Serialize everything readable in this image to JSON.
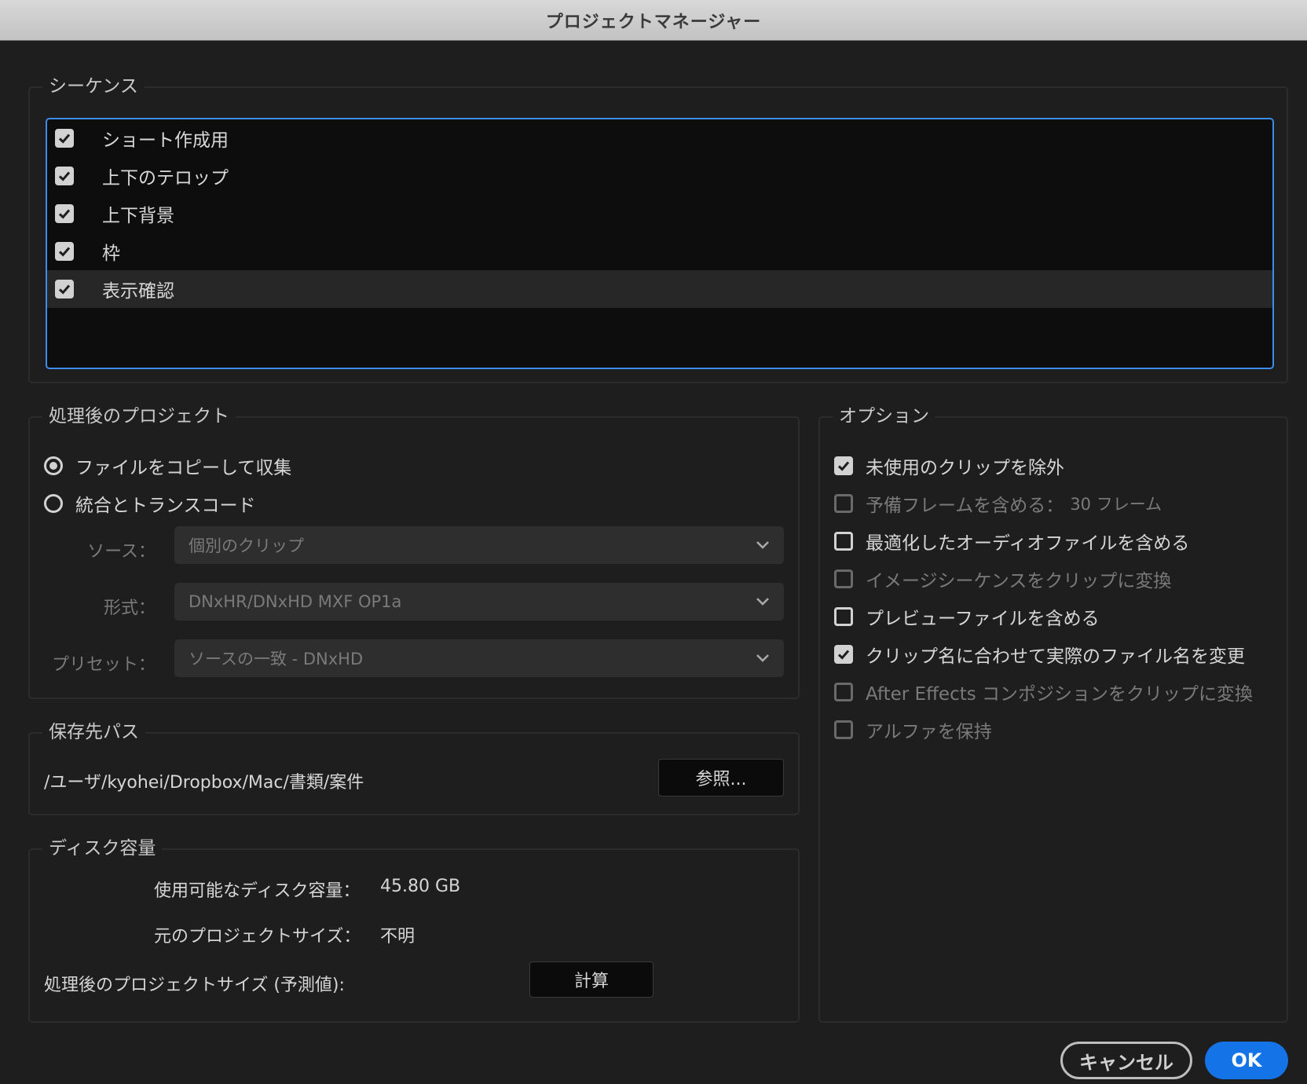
{
  "window": {
    "title": "プロジェクトマネージャー"
  },
  "sequences": {
    "legend": "シーケンス",
    "items": [
      {
        "label": "ショート作成用",
        "checked": true
      },
      {
        "label": "上下のテロップ",
        "checked": true
      },
      {
        "label": "上下背景",
        "checked": true
      },
      {
        "label": "枠",
        "checked": true
      },
      {
        "label": "表示確認",
        "checked": true
      }
    ]
  },
  "result_project": {
    "legend": "処理後のプロジェクト",
    "collect_label": "ファイルをコピーして収集",
    "transcode_label": "統合とトランスコード",
    "selected": "collect",
    "source_label": "ソース：",
    "source_value": "個別のクリップ",
    "format_label": "形式：",
    "format_value": "DNxHR/DNxHD MXF OP1a",
    "preset_label": "プリセット：",
    "preset_value": "ソースの一致 - DNxHD"
  },
  "destination": {
    "legend": "保存先パス",
    "path": "/ユーザ/kyohei/Dropbox/Mac/書類/案件",
    "browse_label": "参照..."
  },
  "disk": {
    "legend": "ディスク容量",
    "available_label": "使用可能なディスク容量：",
    "available_value": "45.80 GB",
    "original_label": "元のプロジェクトサイズ：",
    "original_value": "不明",
    "estimated_label": "処理後のプロジェクトサイズ (予測値):",
    "calculate_label": "計算"
  },
  "options": {
    "legend": "オプション",
    "items": [
      {
        "label": "未使用のクリップを除外",
        "checked": true,
        "enabled": true
      },
      {
        "label": "予備フレームを含める：",
        "suffix": "30 フレーム",
        "checked": false,
        "enabled": false
      },
      {
        "label": "最適化したオーディオファイルを含める",
        "checked": false,
        "enabled": true
      },
      {
        "label": "イメージシーケンスをクリップに変換",
        "checked": false,
        "enabled": false
      },
      {
        "label": "プレビューファイルを含める",
        "checked": false,
        "enabled": true
      },
      {
        "label": "クリップ名に合わせて実際のファイル名を変更",
        "checked": true,
        "enabled": true
      },
      {
        "label": "After Effects コンポジションをクリップに変換",
        "checked": false,
        "enabled": false
      },
      {
        "label": "アルファを保持",
        "checked": false,
        "enabled": false
      }
    ]
  },
  "footer": {
    "cancel_label": "キャンセル",
    "ok_label": "OK"
  },
  "colors": {
    "accent": "#1473e6",
    "focus_border": "#3c8de6",
    "background": "#1e1e1e"
  }
}
